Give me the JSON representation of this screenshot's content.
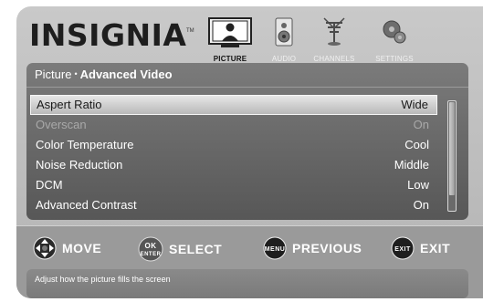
{
  "brand": {
    "logo": "INSIGNIA",
    "trademark": "TM"
  },
  "tabs": [
    {
      "label": "PICTURE",
      "icon": "tv-icon",
      "active": true
    },
    {
      "label": "AUDIO",
      "icon": "speaker-icon",
      "active": false
    },
    {
      "label": "CHANNELS",
      "icon": "antenna-icon",
      "active": false
    },
    {
      "label": "SETTINGS",
      "icon": "gears-icon",
      "active": false
    }
  ],
  "breadcrumb": {
    "parent": "Picture",
    "separator": "•",
    "current": "Advanced Video"
  },
  "menu": {
    "items": [
      {
        "label": "Aspert Ratio",
        "value": "Wide",
        "selected": true,
        "disabled": false
      },
      {
        "label": "Overscan",
        "value": "On",
        "selected": false,
        "disabled": true
      },
      {
        "label": "Color Temperature",
        "value": "Cool",
        "selected": false,
        "disabled": false
      },
      {
        "label": "Noise Reduction",
        "value": "Middle",
        "selected": false,
        "disabled": false
      },
      {
        "label": "DCM",
        "value": "Low",
        "selected": false,
        "disabled": false
      },
      {
        "label": "Advanced Contrast",
        "value": "On",
        "selected": false,
        "disabled": false
      }
    ]
  },
  "nav_hints": {
    "move": {
      "label": "MOVE",
      "icon": "dpad-icon"
    },
    "select": {
      "label": "SELECT",
      "button_top": "OK",
      "button_bottom": "ENTER",
      "icon": "ok-enter-button-icon"
    },
    "previous": {
      "label": "PREVIOUS",
      "button": "MENU",
      "icon": "menu-button-icon"
    },
    "exit": {
      "label": "EXIT",
      "button": "EXIT",
      "icon": "exit-button-icon"
    }
  },
  "help_text": "Adjust how the picture fills the screen",
  "colors": {
    "panel": "#6a6a6a",
    "selected_row": "#d0d0d0",
    "background": "#bebebe"
  }
}
